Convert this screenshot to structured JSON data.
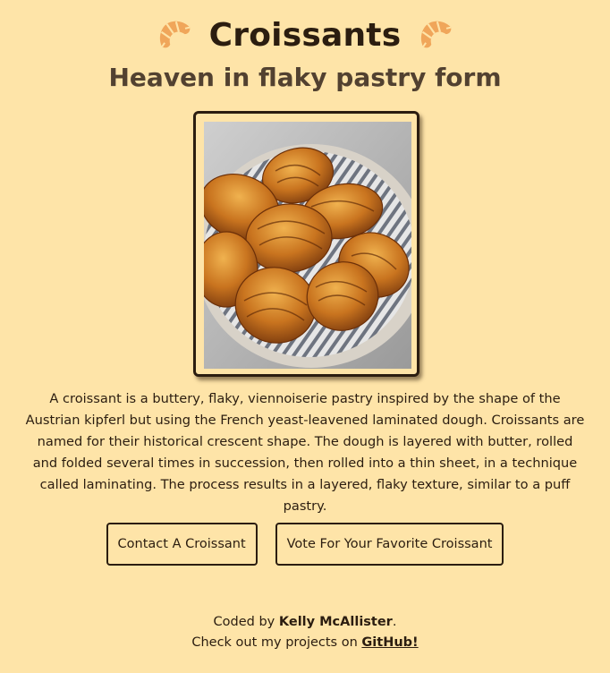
{
  "header": {
    "title": "Croissants",
    "subtitle": "Heaven in flaky pastry form",
    "left_icon": "croissant-icon",
    "right_icon": "croissant-icon"
  },
  "photo": {
    "subject": "basket of croissants"
  },
  "description": "A croissant is a buttery, flaky, viennoiserie pastry inspired by the shape of the Austrian kipferl but using the French yeast-leavened laminated dough. Croissants are named for their historical crescent shape. The dough is layered with butter, rolled and folded several times in succession, then rolled into a thin sheet, in a technique called laminating. The process results in a layered, flaky texture, similar to a puff pastry.",
  "buttons": {
    "contact_label": "Contact A Croissant",
    "vote_label": "Vote For Your Favorite Croissant"
  },
  "footer": {
    "coded_by_prefix": "Coded by ",
    "author": "Kelly McAllister",
    "coded_by_suffix": ".",
    "projects_prefix": "Check out my projects on ",
    "github_label": "GitHub!"
  },
  "colors": {
    "background": "#fee4a8",
    "text": "#2b1d10",
    "subtitle": "#524130",
    "croissant_icon": "#f0a65a"
  }
}
